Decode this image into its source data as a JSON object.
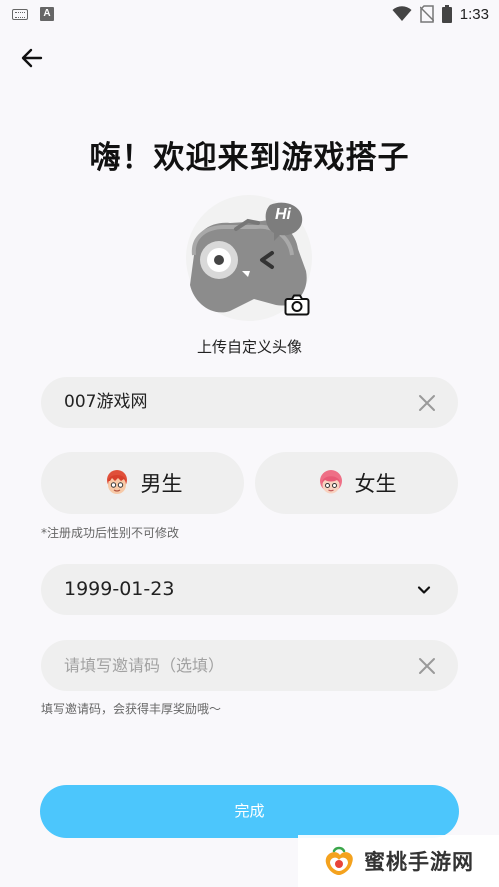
{
  "status_bar": {
    "time": "1:33",
    "left_icons": [
      "keyboard-icon",
      "a-notification-icon"
    ],
    "a_icon_letter": "A",
    "right_icons": [
      "wifi-icon",
      "no-sim-icon",
      "battery-icon"
    ]
  },
  "header": {
    "back_icon": "arrow-left-icon"
  },
  "title": "嗨！欢迎来到游戏搭子",
  "avatar": {
    "caption": "上传自定义头像",
    "badge_text": "Hi",
    "camera_icon": "camera-icon"
  },
  "nickname": {
    "value": "007游戏网",
    "clear_icon": "close-icon"
  },
  "gender": {
    "male_label": "男生",
    "female_label": "女生",
    "note": "*注册成功后性别不可修改"
  },
  "birthday": {
    "value": "1999-01-23",
    "dropdown_icon": "chevron-down-icon"
  },
  "invite_code": {
    "placeholder": "请填写邀请码（选填）",
    "clear_icon": "close-icon",
    "note": "填写邀请码，会获得丰厚奖励哦～"
  },
  "submit": {
    "label": "完成"
  },
  "watermark": {
    "text": "蜜桃手游网"
  },
  "colors": {
    "background": "#f9f8fb",
    "field": "#efefef",
    "primary_button": "#4cc6fc",
    "note_text": "#666666",
    "placeholder": "#a2a2a2"
  }
}
